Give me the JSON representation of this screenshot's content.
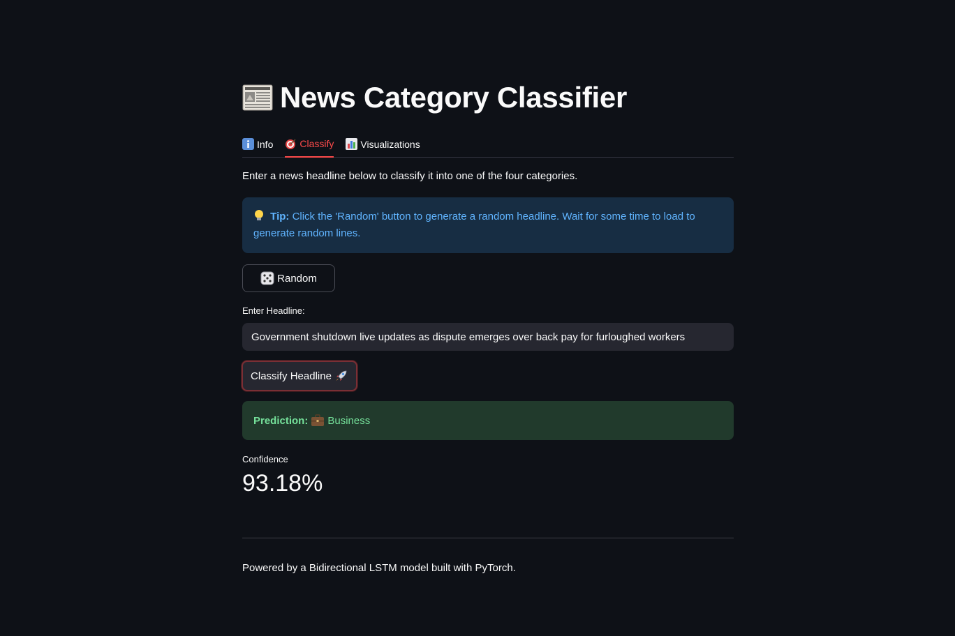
{
  "app": {
    "title": "News Category Classifier"
  },
  "tabs": [
    {
      "label": "Info",
      "icon": "info-icon",
      "active": false
    },
    {
      "label": "Classify",
      "icon": "target-icon",
      "active": true
    },
    {
      "label": "Visualizations",
      "icon": "bar-chart-icon",
      "active": false
    }
  ],
  "classify": {
    "intro": "Enter a news headline below to classify it into one of the four categories.",
    "tip_label": "Tip:",
    "tip_text": "Click the 'Random' button to generate a random headline. Wait for some time to load to generate random lines.",
    "random_button": "Random",
    "headline_label": "Enter Headline:",
    "headline_value": "Government shutdown live updates as dispute emerges over back pay for furloughed workers",
    "classify_button": "Classify Headline",
    "prediction_label": "Prediction:",
    "prediction_value": "Business",
    "confidence_label": "Confidence",
    "confidence_value": "93.18%"
  },
  "footer": {
    "text": "Powered by a Bidirectional LSTM model built with PyTorch."
  },
  "colors": {
    "background": "#0e1117",
    "accent": "#ff4b4b",
    "info_bg": "#172d43",
    "info_text": "#60b4ff",
    "success_bg": "#213a2c",
    "success_text": "#75e09a"
  }
}
